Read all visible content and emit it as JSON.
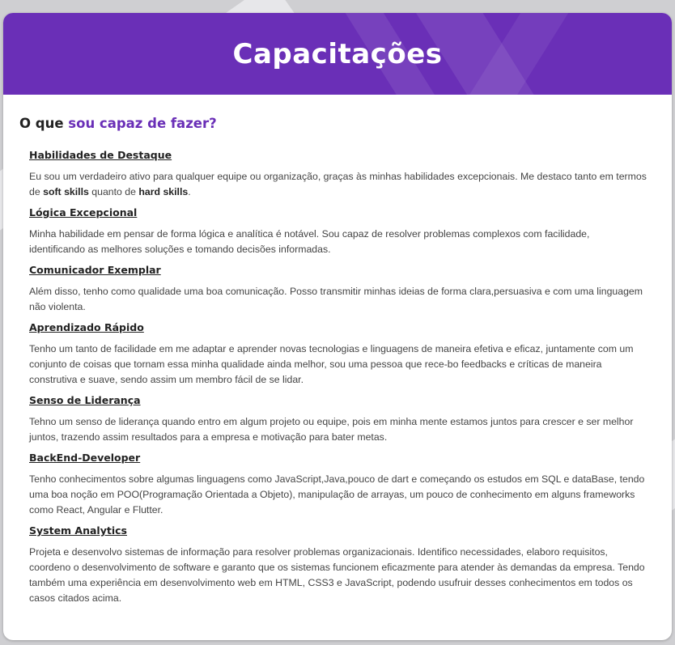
{
  "header": {
    "title": "Capacitações"
  },
  "intro": {
    "prefix": "O que",
    "accent": "sou capaz de fazer?"
  },
  "sections": [
    {
      "title": "Habilidades de Destaque",
      "text_a": "Eu sou um verdadeiro ativo para qualquer equipe ou organização, graças às minhas habilidades excepcionais. Me destaco tanto em termos de ",
      "bold_a": "soft skills",
      "text_b": " quanto de ",
      "bold_b": "hard skills",
      "text_c": "."
    },
    {
      "title": "Lógica Excepcional",
      "text": "Minha habilidade em pensar de forma lógica e analítica é notável. Sou capaz de resolver problemas complexos com facilidade, identificando as melhores soluções e tomando decisões informadas."
    },
    {
      "title": "Comunicador Exemplar",
      "text": "Além disso, tenho como qualidade uma boa comunicação. Posso transmitir minhas ideias de forma clara,persuasiva e com uma linguagem não violenta."
    },
    {
      "title": "Aprendizado Rápido",
      "text": "Tenho um tanto de facilidade em me adaptar e aprender novas tecnologias e linguagens de maneira efetiva e eficaz, juntamente com um conjunto de coisas que tornam essa minha qualidade ainda melhor, sou uma pessoa que rece-bo feedbacks e críticas de maneira construtiva e suave, sendo assim um membro fácil de se lidar."
    },
    {
      "title": "Senso de Liderança",
      "text": "Tehno um senso de liderança quando entro em algum projeto ou equipe, pois em minha mente estamos juntos para crescer e ser melhor juntos, trazendo assim resultados para a empresa e motivação para bater metas."
    },
    {
      "title": "BackEnd-Developer",
      "text": "Tenho conhecimentos sobre algumas linguagens como JavaScript,Java,pouco de dart e começando os estudos em SQL e dataBase, tendo uma boa noção em POO(Programação Orientada a Objeto), manipulação de arrayas, um pouco de conhecimento em alguns frameworks como React, Angular e Flutter."
    },
    {
      "title": "System Analytics",
      "text": "Projeta e desenvolvo sistemas de informação para resolver problemas organizacionais. Identifico necessidades, elaboro requisitos, coordeno o desenvolvimento de software e garanto que os sistemas funcionem eficazmente para atender às demandas da empresa. Tendo também uma experiência em desenvolvimento web em HTML, CSS3 e JavaScript, podendo usufruir desses conhecimentos em todos os casos citados acima."
    }
  ]
}
